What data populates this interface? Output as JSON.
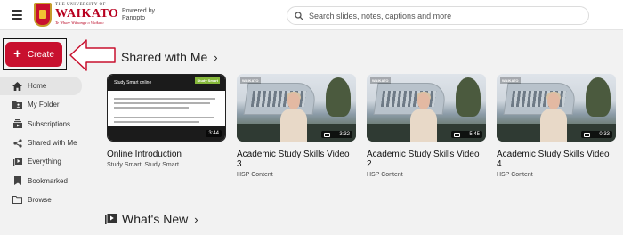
{
  "header": {
    "menu_icon": "hamburger-icon",
    "university_small": "THE UNIVERSITY OF",
    "university_name": "WAIKATO",
    "motto": "Te Whare Wānanga o Waikato",
    "powered_line1": "Powered by",
    "powered_line2": "Panopto",
    "search_placeholder": "Search slides, notes, captions and more",
    "search_icon": "search-icon"
  },
  "create_button": {
    "label": "Create",
    "icon": "plus-icon"
  },
  "sidebar": {
    "items": [
      {
        "label": "Home",
        "icon": "home-icon",
        "active": true
      },
      {
        "label": "My Folder",
        "icon": "folder-user-icon"
      },
      {
        "label": "Subscriptions",
        "icon": "subscriptions-icon"
      },
      {
        "label": "Shared with Me",
        "icon": "share-icon"
      },
      {
        "label": "Everything",
        "icon": "video-library-icon"
      },
      {
        "label": "Bookmarked",
        "icon": "bookmark-icon"
      },
      {
        "label": "Browse",
        "icon": "folder-icon"
      }
    ]
  },
  "shared": {
    "title": "Shared with Me",
    "cards": [
      {
        "title": "Online Introduction",
        "subtitle": "Study Smart: Study Smart",
        "duration": "3:44",
        "slide_heading": "Study Smart online",
        "slide_badge": "Study Smart"
      },
      {
        "title": "Academic Study Skills Video 3",
        "subtitle": "HSP Content",
        "duration": "3:32",
        "watermark": "WAIKATO"
      },
      {
        "title": "Academic Study Skills Video 2",
        "subtitle": "HSP Content",
        "duration": "5:45",
        "watermark": "WAIKATO"
      },
      {
        "title": "Academic Study Skills Video 4",
        "subtitle": "HSP Content",
        "duration": "0:33",
        "watermark": "WAIKATO"
      }
    ]
  },
  "whats_new": {
    "title": "What's New",
    "icon": "video-library-icon"
  },
  "colors": {
    "brand_red": "#c8102e",
    "background": "#f2f2f2"
  }
}
